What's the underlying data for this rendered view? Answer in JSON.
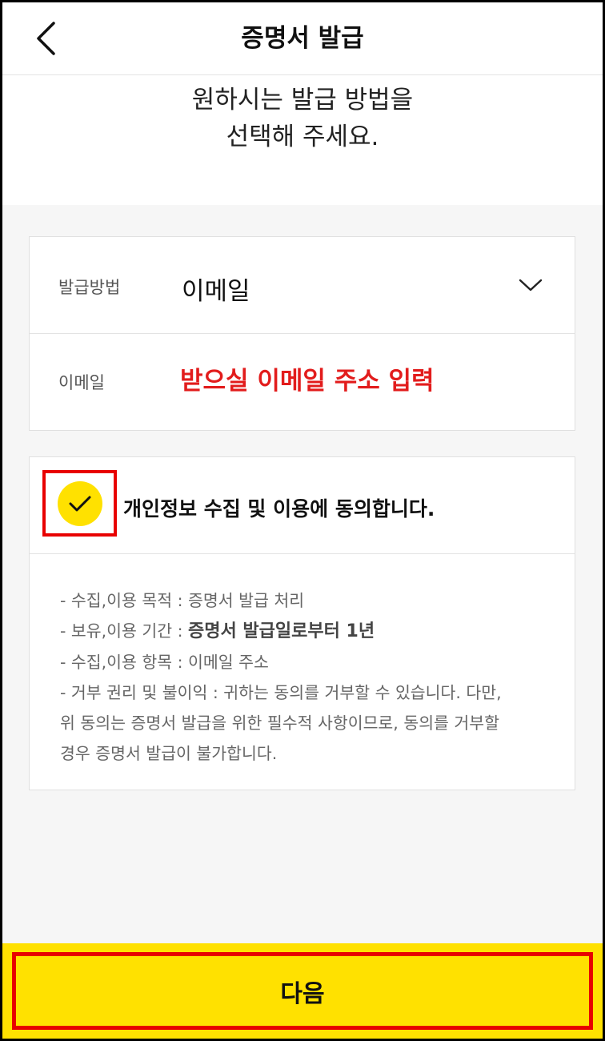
{
  "header": {
    "title": "증명서 발급",
    "back_icon": "chevron-left-icon"
  },
  "intro": {
    "line1": "원하시는 발급 방법을",
    "line2": "선택해 주세요."
  },
  "form": {
    "method_label": "발급방법",
    "method_value": "이메일",
    "dropdown_icon": "chevron-down-icon",
    "email_label": "이메일",
    "email_placeholder": "받으실 이메일 주소 입력",
    "email_value": ""
  },
  "consent": {
    "checked": true,
    "check_icon": "checkmark-icon",
    "label": "개인정보 수집 및 이용에 동의합니다.",
    "terms": {
      "purpose": "- 수집,이용 목적 : 증명서 발급 처리",
      "period_prefix": "- 보유,이용 기간 : ",
      "period_value": "증명서 발급일로부터 1년",
      "items": "- 수집,이용 항목 : 이메일 주소",
      "refusal_1": "- 거부 권리 및 불이익 : 귀하는 동의를 거부할 수 있습니다. 다만,",
      "refusal_2": "위 동의는 증명서 발급을 위한 필수적 사항이므로, 동의를 거부할",
      "refusal_3": "경우 증명서 발급이 불가합니다."
    }
  },
  "footer": {
    "next_label": "다음"
  },
  "colors": {
    "accent": "#ffe100",
    "highlight": "#e80000",
    "placeholder": "#e21c1c"
  }
}
